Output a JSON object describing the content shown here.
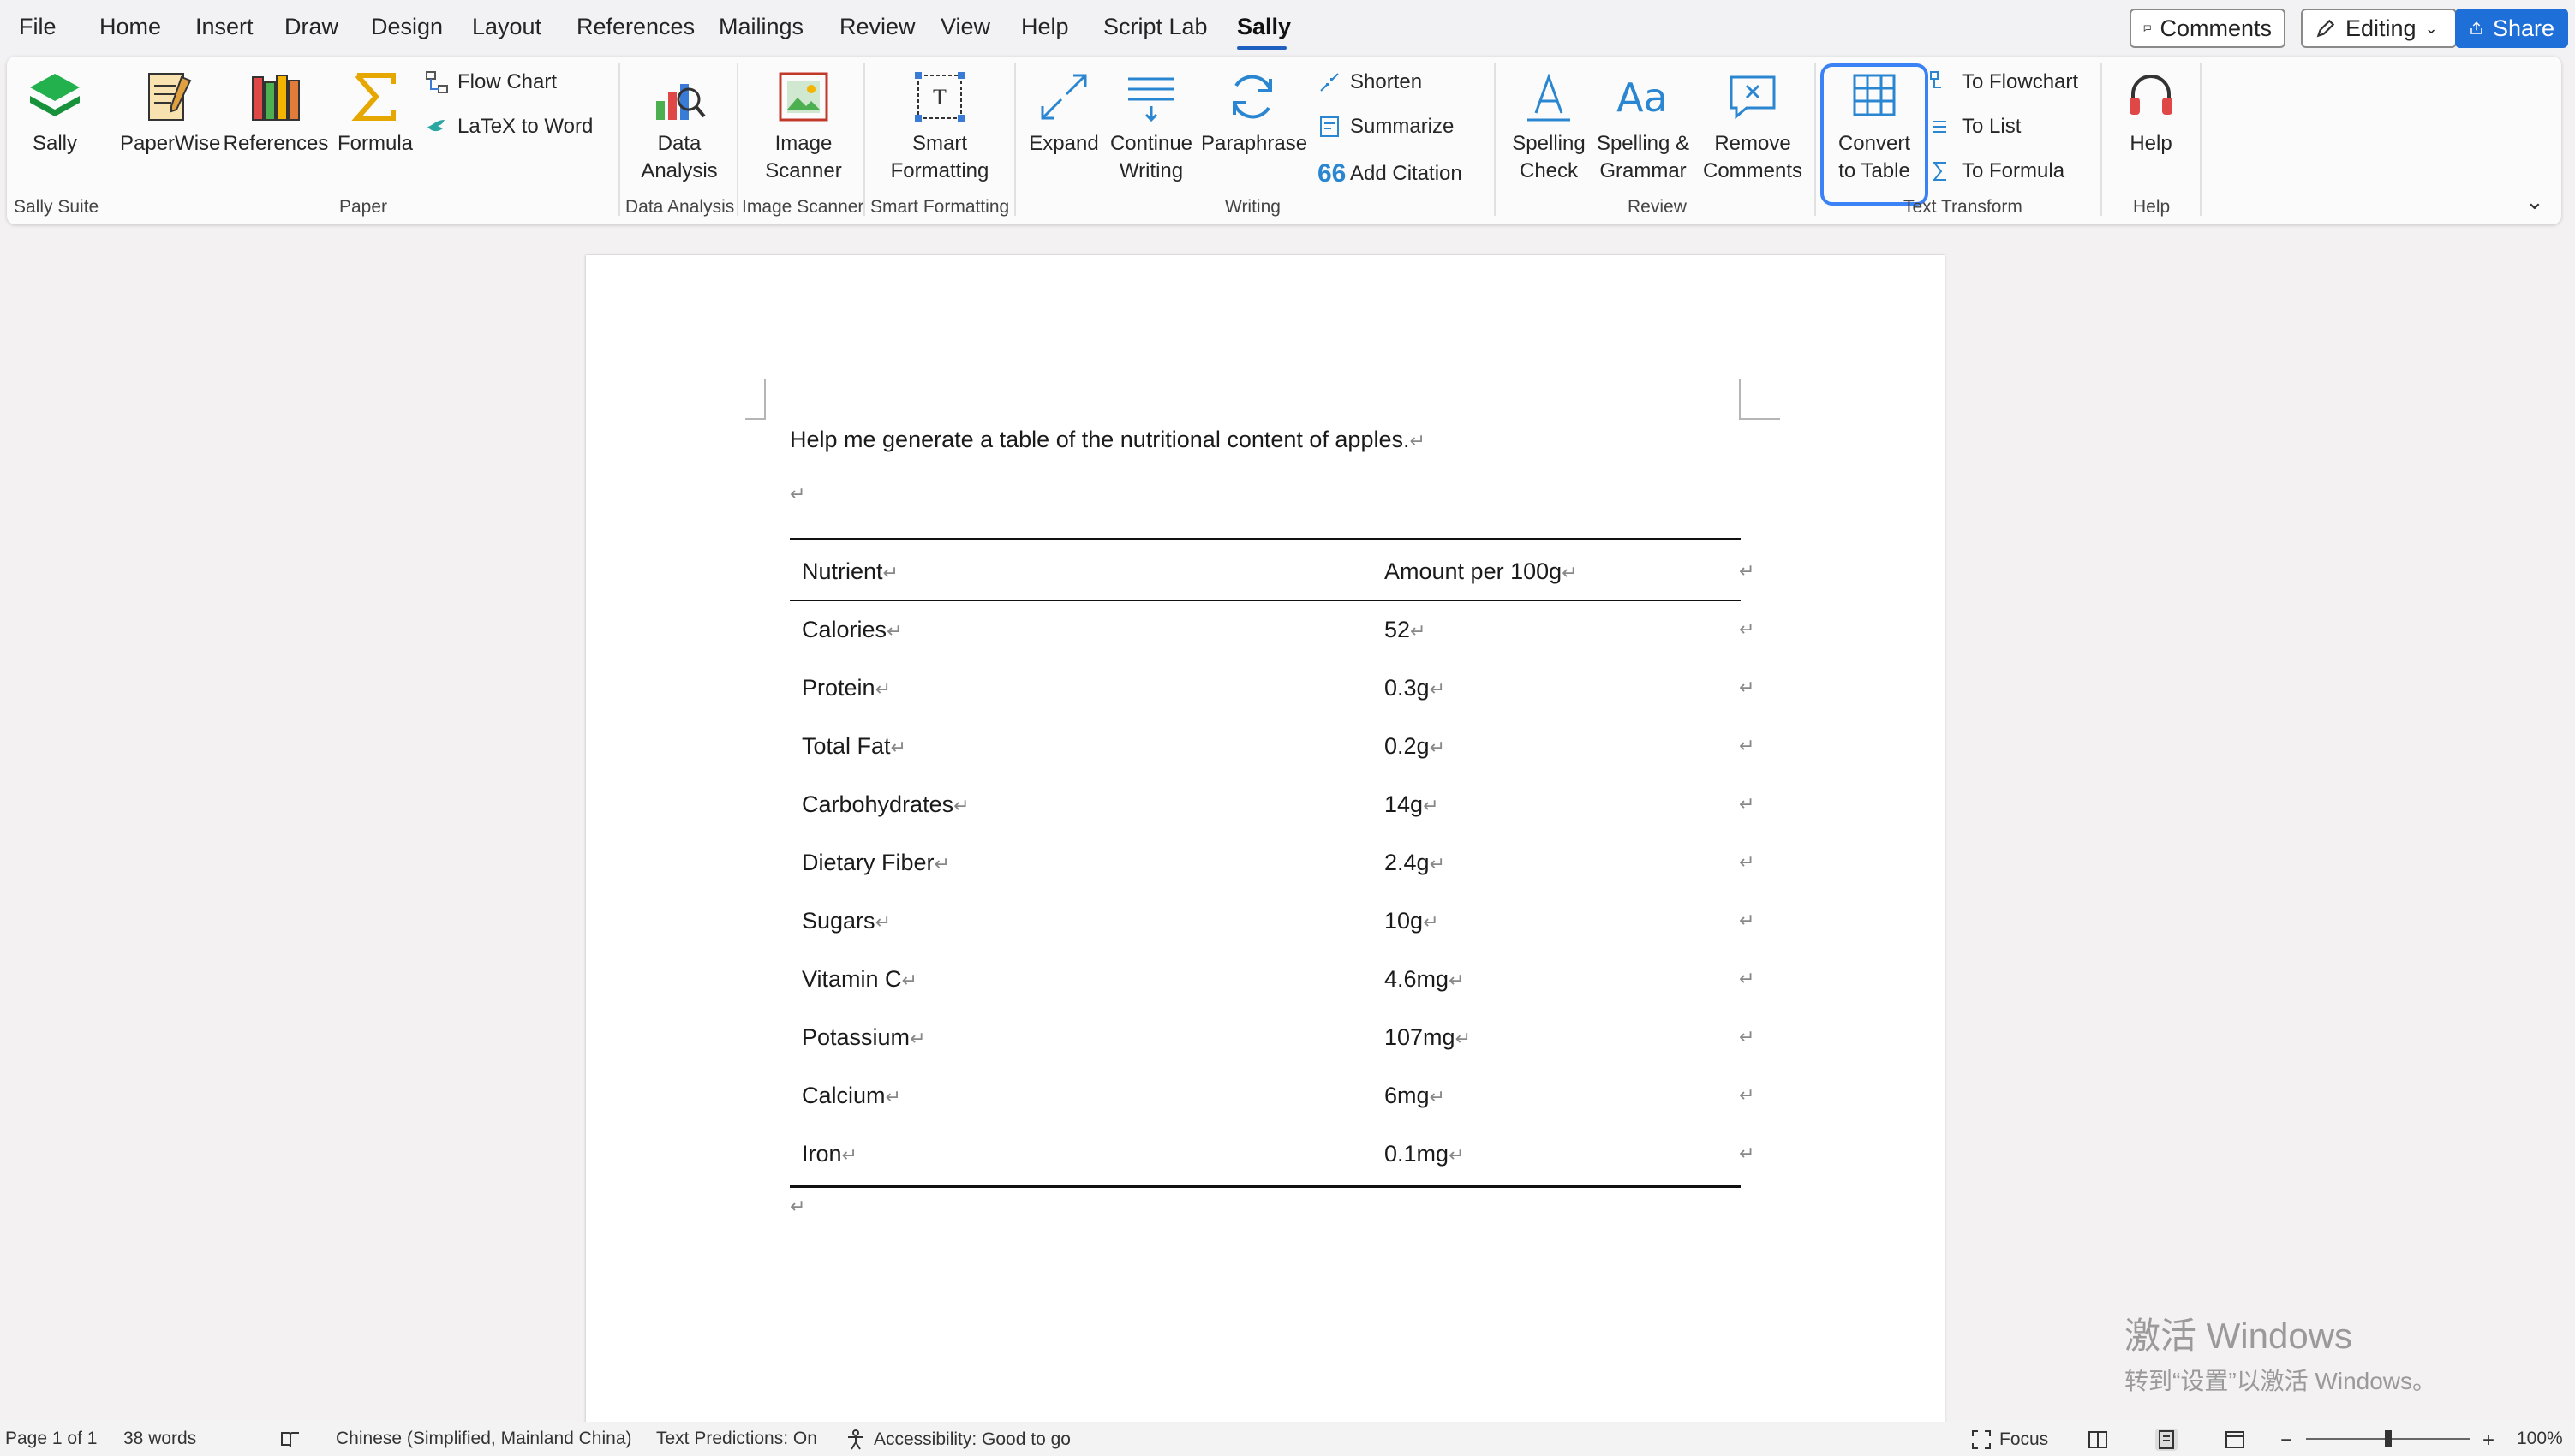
{
  "menu": {
    "items": [
      "File",
      "Home",
      "Insert",
      "Draw",
      "Design",
      "Layout",
      "References",
      "Mailings",
      "Review",
      "View",
      "Help",
      "Script Lab",
      "Sally"
    ],
    "active": "Sally",
    "comments_label": "Comments",
    "editing_label": "Editing",
    "share_label": "Share"
  },
  "ribbon": {
    "sally": "Sally",
    "paperwise": "PaperWise",
    "references": "References",
    "formula": "Formula",
    "flow_chart": "Flow Chart",
    "latex_to_word": "LaTeX to Word",
    "data_analysis": [
      "Data",
      "Analysis"
    ],
    "image_scanner": [
      "Image",
      "Scanner"
    ],
    "smart_formatting": [
      "Smart",
      "Formatting"
    ],
    "expand": "Expand",
    "continue_writing": [
      "Continue",
      "Writing"
    ],
    "paraphrase": "Paraphrase",
    "shorten": "Shorten",
    "summarize": "Summarize",
    "add_citation": "Add Citation",
    "spelling_check": [
      "Spelling",
      "Check"
    ],
    "spelling_grammar": [
      "Spelling &",
      "Grammar"
    ],
    "remove_comments": [
      "Remove",
      "Comments"
    ],
    "convert_to_table": [
      "Convert",
      "to Table"
    ],
    "to_flowchart": "To Flowchart",
    "to_list": "To List",
    "to_formula": "To Formula",
    "help": "Help",
    "groups": {
      "sally_suite": "Sally Suite",
      "paper": "Paper",
      "data_analysis": "Data Analysis",
      "image_scanner": "Image Scanner",
      "smart_formatting": "Smart Formatting",
      "writing": "Writing",
      "review": "Review",
      "text_transform": "Text Transform",
      "help": "Help"
    }
  },
  "document": {
    "prompt": "Help me generate a table of the nutritional content of apples.",
    "table": {
      "headers": [
        "Nutrient",
        "Amount per 100g"
      ],
      "rows": [
        [
          "Calories",
          "52"
        ],
        [
          "Protein",
          "0.3g"
        ],
        [
          "Total Fat",
          "0.2g"
        ],
        [
          "Carbohydrates",
          "14g"
        ],
        [
          "Dietary Fiber",
          "2.4g"
        ],
        [
          "Sugars",
          "10g"
        ],
        [
          "Vitamin C",
          "4.6mg"
        ],
        [
          "Potassium",
          "107mg"
        ],
        [
          "Calcium",
          "6mg"
        ],
        [
          "Iron",
          "0.1mg"
        ]
      ]
    },
    "paragraph_mark": "↵"
  },
  "watermark": {
    "line1": "激活 Windows",
    "line2": "转到“设置”以激活 Windows。"
  },
  "status": {
    "page": "Page 1 of 1",
    "words": "38 words",
    "language": "Chinese (Simplified, Mainland China)",
    "predictions": "Text Predictions: On",
    "accessibility": "Accessibility: Good to go",
    "focus": "Focus",
    "zoom": "100%"
  }
}
